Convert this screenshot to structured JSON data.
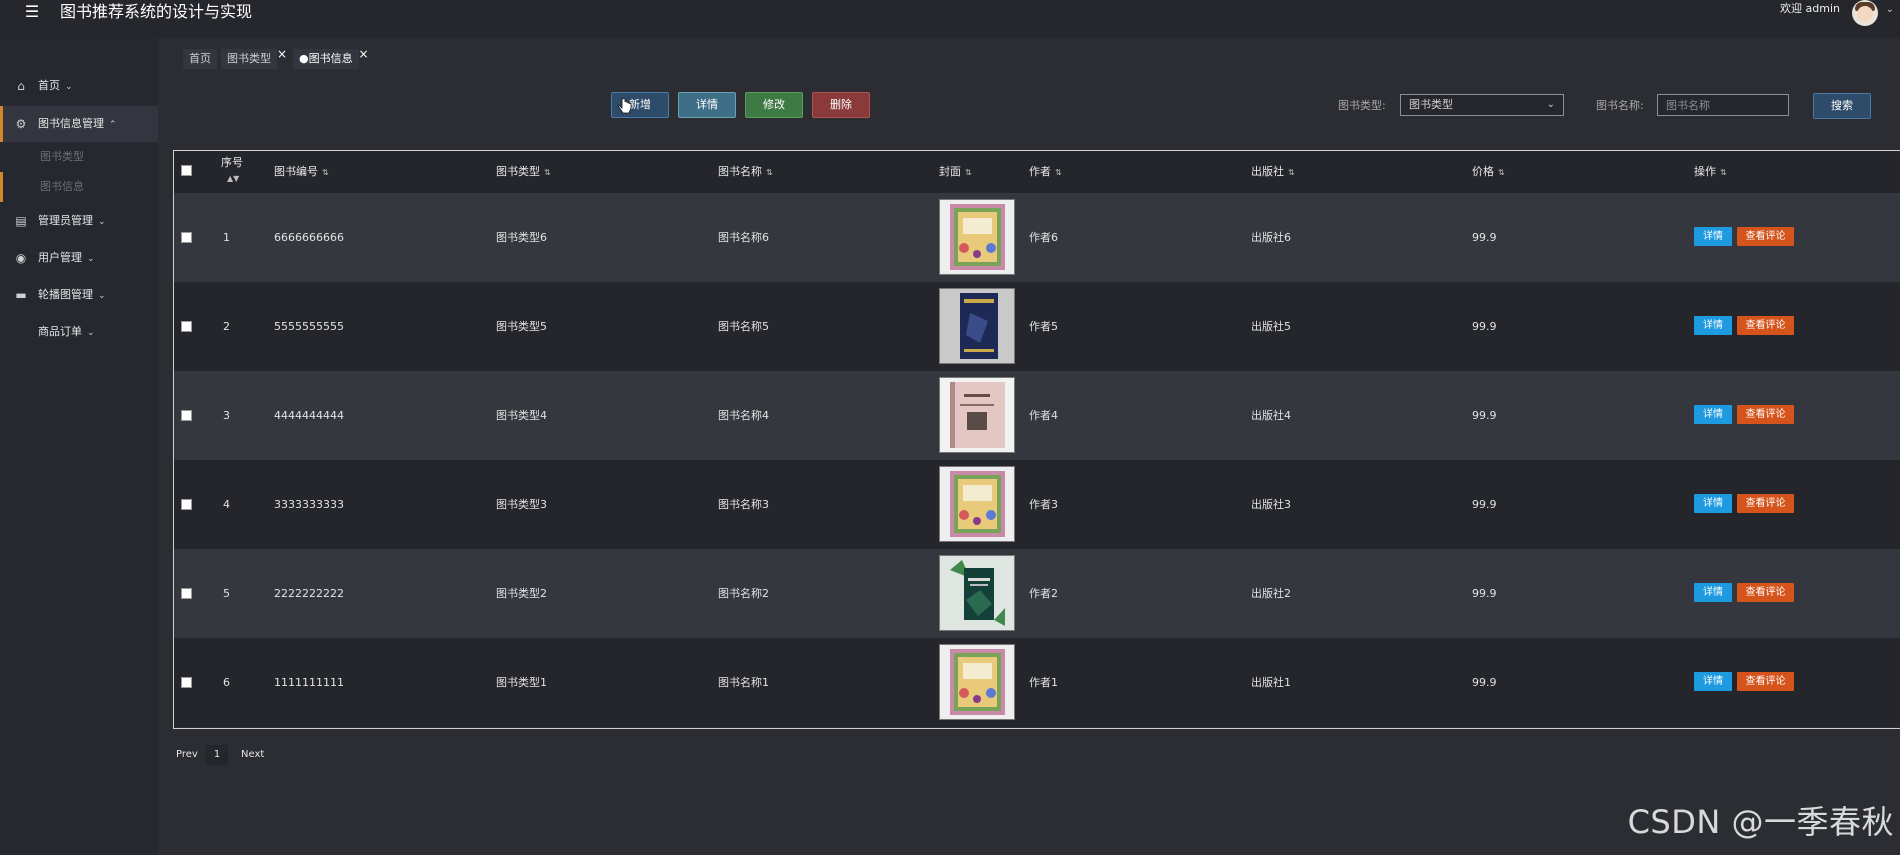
{
  "header": {
    "menu_icon": "hamburger-icon",
    "title": "图书推荐系统的设计与实现",
    "welcome": "欢迎 admin"
  },
  "sidebar": {
    "items": [
      {
        "label": "首页",
        "icon": "home-icon",
        "caret": "⌄"
      },
      {
        "label": "图书信息管理",
        "icon": "gear-chip-icon",
        "caret": "⌃"
      },
      {
        "label": "管理员管理",
        "icon": "table-icon",
        "caret": "⌄"
      },
      {
        "label": "用户管理",
        "icon": "user-badge-icon",
        "caret": "⌄"
      },
      {
        "label": "轮播图管理",
        "icon": "carousel-icon",
        "caret": "⌄"
      },
      {
        "label": "商品订单",
        "icon": "",
        "caret": "⌄"
      }
    ],
    "sub_items": [
      {
        "label": "图书类型"
      },
      {
        "label": "图书信息"
      }
    ]
  },
  "tabs": [
    {
      "label": "首页"
    },
    {
      "label": "图书类型"
    },
    {
      "label": "●图书信息"
    }
  ],
  "toolbar": {
    "add_label": "新增",
    "detail_label": "详情",
    "edit_label": "修改",
    "delete_label": "删除"
  },
  "search": {
    "type_label": "图书类型:",
    "type_value": "图书类型",
    "name_label": "图书名称:",
    "name_placeholder": "图书名称",
    "button_label": "搜索"
  },
  "table": {
    "columns": [
      "序号",
      "图书编号",
      "图书类型",
      "图书名称",
      "封面",
      "作者",
      "出版社",
      "价格",
      "操作"
    ],
    "rows": [
      {
        "seq": "1",
        "code": "6666666666",
        "type": "图书类型6",
        "name": "图书名称6",
        "author": "作者6",
        "publisher": "出版社6",
        "price": "99.9",
        "cover": "floral-pink-cover"
      },
      {
        "seq": "2",
        "code": "5555555555",
        "type": "图书类型5",
        "name": "图书名称5",
        "author": "作者5",
        "publisher": "出版社5",
        "price": "99.9",
        "cover": "navy-cover"
      },
      {
        "seq": "3",
        "code": "4444444444",
        "type": "图书类型4",
        "name": "图书名称4",
        "author": "作者4",
        "publisher": "出版社4",
        "price": "99.9",
        "cover": "pink-plain-cover"
      },
      {
        "seq": "4",
        "code": "3333333333",
        "type": "图书类型3",
        "name": "图书名称3",
        "author": "作者3",
        "publisher": "出版社3",
        "price": "99.9",
        "cover": "floral-pink-cover"
      },
      {
        "seq": "5",
        "code": "2222222222",
        "type": "图书类型2",
        "name": "图书名称2",
        "author": "作者2",
        "publisher": "出版社2",
        "price": "99.9",
        "cover": "green-leaf-cover"
      },
      {
        "seq": "6",
        "code": "1111111111",
        "type": "图书类型1",
        "name": "图书名称1",
        "author": "作者1",
        "publisher": "出版社1",
        "price": "99.9",
        "cover": "floral-pink-cover"
      }
    ],
    "row_actions": {
      "detail": "详情",
      "review": "查看评论"
    }
  },
  "pagination": {
    "prev": "Prev",
    "page": "1",
    "next": "Next"
  },
  "watermark": "CSDN @一季春秋",
  "colors": {
    "accent": "#d4872a",
    "info_button": "#1e9ae0",
    "review_button": "#d4541c",
    "add_button": "#2e4b6a",
    "edit_button": "#3e7a43",
    "delete_button": "#8a3a3a"
  }
}
